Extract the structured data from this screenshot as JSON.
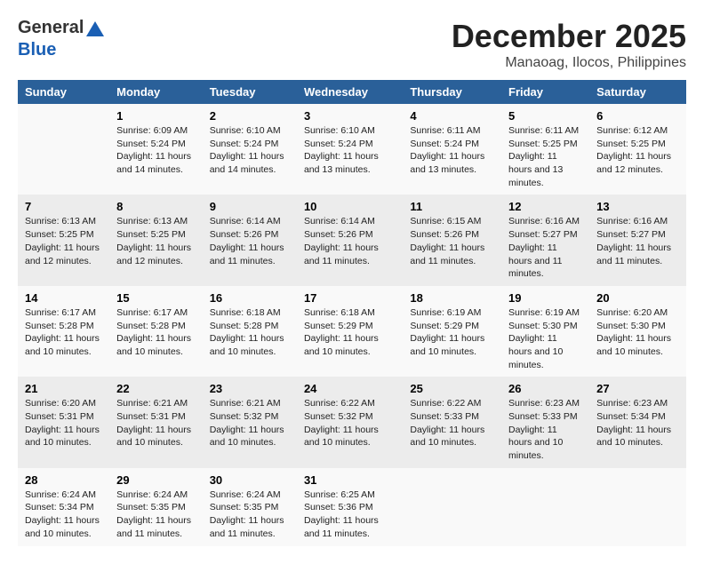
{
  "header": {
    "logo_general": "General",
    "logo_blue": "Blue",
    "month": "December 2025",
    "location": "Manaoag, Ilocos, Philippines"
  },
  "weekdays": [
    "Sunday",
    "Monday",
    "Tuesday",
    "Wednesday",
    "Thursday",
    "Friday",
    "Saturday"
  ],
  "weeks": [
    [
      {
        "day": "",
        "sunrise": "",
        "sunset": "",
        "daylight": ""
      },
      {
        "day": "1",
        "sunrise": "Sunrise: 6:09 AM",
        "sunset": "Sunset: 5:24 PM",
        "daylight": "Daylight: 11 hours and 14 minutes."
      },
      {
        "day": "2",
        "sunrise": "Sunrise: 6:10 AM",
        "sunset": "Sunset: 5:24 PM",
        "daylight": "Daylight: 11 hours and 14 minutes."
      },
      {
        "day": "3",
        "sunrise": "Sunrise: 6:10 AM",
        "sunset": "Sunset: 5:24 PM",
        "daylight": "Daylight: 11 hours and 13 minutes."
      },
      {
        "day": "4",
        "sunrise": "Sunrise: 6:11 AM",
        "sunset": "Sunset: 5:24 PM",
        "daylight": "Daylight: 11 hours and 13 minutes."
      },
      {
        "day": "5",
        "sunrise": "Sunrise: 6:11 AM",
        "sunset": "Sunset: 5:25 PM",
        "daylight": "Daylight: 11 hours and 13 minutes."
      },
      {
        "day": "6",
        "sunrise": "Sunrise: 6:12 AM",
        "sunset": "Sunset: 5:25 PM",
        "daylight": "Daylight: 11 hours and 12 minutes."
      }
    ],
    [
      {
        "day": "7",
        "sunrise": "Sunrise: 6:13 AM",
        "sunset": "Sunset: 5:25 PM",
        "daylight": "Daylight: 11 hours and 12 minutes."
      },
      {
        "day": "8",
        "sunrise": "Sunrise: 6:13 AM",
        "sunset": "Sunset: 5:25 PM",
        "daylight": "Daylight: 11 hours and 12 minutes."
      },
      {
        "day": "9",
        "sunrise": "Sunrise: 6:14 AM",
        "sunset": "Sunset: 5:26 PM",
        "daylight": "Daylight: 11 hours and 11 minutes."
      },
      {
        "day": "10",
        "sunrise": "Sunrise: 6:14 AM",
        "sunset": "Sunset: 5:26 PM",
        "daylight": "Daylight: 11 hours and 11 minutes."
      },
      {
        "day": "11",
        "sunrise": "Sunrise: 6:15 AM",
        "sunset": "Sunset: 5:26 PM",
        "daylight": "Daylight: 11 hours and 11 minutes."
      },
      {
        "day": "12",
        "sunrise": "Sunrise: 6:16 AM",
        "sunset": "Sunset: 5:27 PM",
        "daylight": "Daylight: 11 hours and 11 minutes."
      },
      {
        "day": "13",
        "sunrise": "Sunrise: 6:16 AM",
        "sunset": "Sunset: 5:27 PM",
        "daylight": "Daylight: 11 hours and 11 minutes."
      }
    ],
    [
      {
        "day": "14",
        "sunrise": "Sunrise: 6:17 AM",
        "sunset": "Sunset: 5:28 PM",
        "daylight": "Daylight: 11 hours and 10 minutes."
      },
      {
        "day": "15",
        "sunrise": "Sunrise: 6:17 AM",
        "sunset": "Sunset: 5:28 PM",
        "daylight": "Daylight: 11 hours and 10 minutes."
      },
      {
        "day": "16",
        "sunrise": "Sunrise: 6:18 AM",
        "sunset": "Sunset: 5:28 PM",
        "daylight": "Daylight: 11 hours and 10 minutes."
      },
      {
        "day": "17",
        "sunrise": "Sunrise: 6:18 AM",
        "sunset": "Sunset: 5:29 PM",
        "daylight": "Daylight: 11 hours and 10 minutes."
      },
      {
        "day": "18",
        "sunrise": "Sunrise: 6:19 AM",
        "sunset": "Sunset: 5:29 PM",
        "daylight": "Daylight: 11 hours and 10 minutes."
      },
      {
        "day": "19",
        "sunrise": "Sunrise: 6:19 AM",
        "sunset": "Sunset: 5:30 PM",
        "daylight": "Daylight: 11 hours and 10 minutes."
      },
      {
        "day": "20",
        "sunrise": "Sunrise: 6:20 AM",
        "sunset": "Sunset: 5:30 PM",
        "daylight": "Daylight: 11 hours and 10 minutes."
      }
    ],
    [
      {
        "day": "21",
        "sunrise": "Sunrise: 6:20 AM",
        "sunset": "Sunset: 5:31 PM",
        "daylight": "Daylight: 11 hours and 10 minutes."
      },
      {
        "day": "22",
        "sunrise": "Sunrise: 6:21 AM",
        "sunset": "Sunset: 5:31 PM",
        "daylight": "Daylight: 11 hours and 10 minutes."
      },
      {
        "day": "23",
        "sunrise": "Sunrise: 6:21 AM",
        "sunset": "Sunset: 5:32 PM",
        "daylight": "Daylight: 11 hours and 10 minutes."
      },
      {
        "day": "24",
        "sunrise": "Sunrise: 6:22 AM",
        "sunset": "Sunset: 5:32 PM",
        "daylight": "Daylight: 11 hours and 10 minutes."
      },
      {
        "day": "25",
        "sunrise": "Sunrise: 6:22 AM",
        "sunset": "Sunset: 5:33 PM",
        "daylight": "Daylight: 11 hours and 10 minutes."
      },
      {
        "day": "26",
        "sunrise": "Sunrise: 6:23 AM",
        "sunset": "Sunset: 5:33 PM",
        "daylight": "Daylight: 11 hours and 10 minutes."
      },
      {
        "day": "27",
        "sunrise": "Sunrise: 6:23 AM",
        "sunset": "Sunset: 5:34 PM",
        "daylight": "Daylight: 11 hours and 10 minutes."
      }
    ],
    [
      {
        "day": "28",
        "sunrise": "Sunrise: 6:24 AM",
        "sunset": "Sunset: 5:34 PM",
        "daylight": "Daylight: 11 hours and 10 minutes."
      },
      {
        "day": "29",
        "sunrise": "Sunrise: 6:24 AM",
        "sunset": "Sunset: 5:35 PM",
        "daylight": "Daylight: 11 hours and 11 minutes."
      },
      {
        "day": "30",
        "sunrise": "Sunrise: 6:24 AM",
        "sunset": "Sunset: 5:35 PM",
        "daylight": "Daylight: 11 hours and 11 minutes."
      },
      {
        "day": "31",
        "sunrise": "Sunrise: 6:25 AM",
        "sunset": "Sunset: 5:36 PM",
        "daylight": "Daylight: 11 hours and 11 minutes."
      },
      {
        "day": "",
        "sunrise": "",
        "sunset": "",
        "daylight": ""
      },
      {
        "day": "",
        "sunrise": "",
        "sunset": "",
        "daylight": ""
      },
      {
        "day": "",
        "sunrise": "",
        "sunset": "",
        "daylight": ""
      }
    ]
  ]
}
